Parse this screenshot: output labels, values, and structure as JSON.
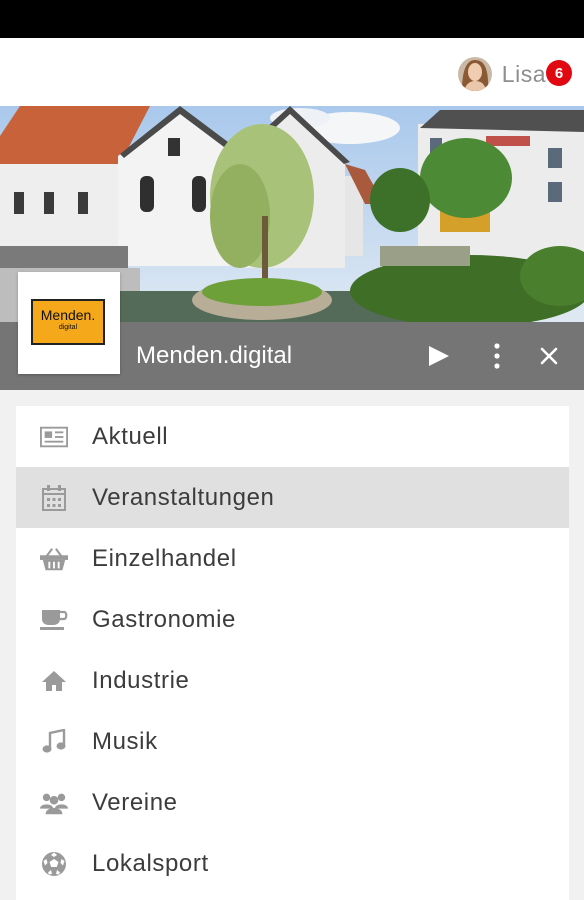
{
  "header": {
    "user_name": "Lisa",
    "notification_count": "6"
  },
  "app": {
    "title": "Menden.digital",
    "logo_line1": "Menden.",
    "logo_line2": "digital"
  },
  "colors": {
    "titlebar": "#757575",
    "badge": "#e00912",
    "active_item": "#e0e0e0",
    "icon": "#9a9a9a",
    "logo_sign": "#f4a81a"
  },
  "menu": {
    "items": [
      {
        "label": "Aktuell",
        "icon": "newspaper-icon"
      },
      {
        "label": "Veranstaltungen",
        "icon": "calendar-icon",
        "active": true
      },
      {
        "label": "Einzelhandel",
        "icon": "shopping-basket-icon"
      },
      {
        "label": "Gastronomie",
        "icon": "coffee-cup-icon"
      },
      {
        "label": "Industrie",
        "icon": "home-icon"
      },
      {
        "label": "Musik",
        "icon": "music-note-icon"
      },
      {
        "label": "Vereine",
        "icon": "group-icon"
      },
      {
        "label": "Lokalsport",
        "icon": "soccer-ball-icon"
      }
    ]
  }
}
